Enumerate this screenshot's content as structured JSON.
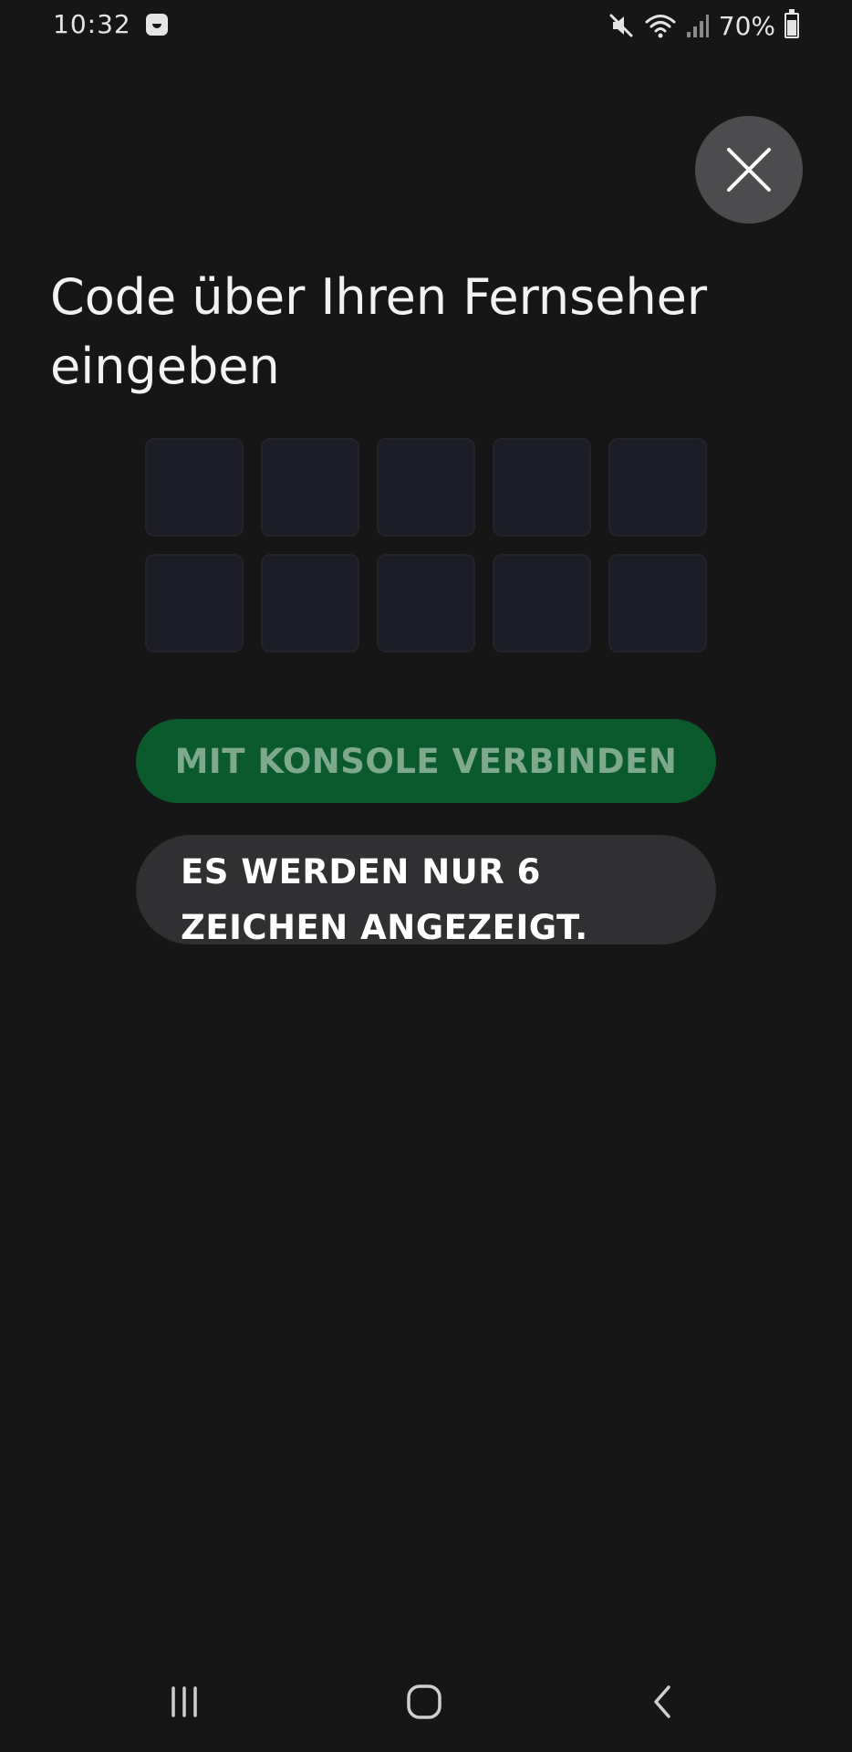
{
  "status_bar": {
    "time": "10:32",
    "battery": "70%",
    "icons": [
      "app-notification-icon",
      "mute-icon",
      "wifi-icon",
      "signal-icon",
      "battery-charging-icon"
    ]
  },
  "dialog": {
    "close_icon": "close-icon",
    "title": "Code über Ihren Fernseher eingeben",
    "code_cells": [
      "",
      "",
      "",
      "",
      "",
      "",
      "",
      "",
      "",
      ""
    ],
    "connect_label": "MIT KONSOLE VERBINDEN",
    "info_text": "ES WERDEN NUR 6 ZEICHEN ANGEZEIGT."
  },
  "nav_bar": {
    "icons": [
      "recent-apps-icon",
      "home-icon",
      "back-icon"
    ]
  },
  "colors": {
    "background": "#161617",
    "accent_green": "#0a5a2b",
    "accent_green_text": "#7fa98b",
    "pill_gray": "#303033",
    "close_circle": "#4c4c4e"
  }
}
